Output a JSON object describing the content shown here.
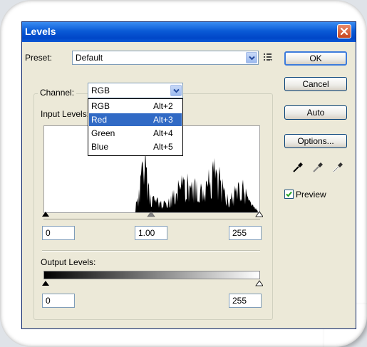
{
  "window": {
    "title": "Levels"
  },
  "preset": {
    "label": "Preset:",
    "value": "Default"
  },
  "buttons": {
    "ok": "OK",
    "cancel": "Cancel",
    "auto": "Auto",
    "options": "Options..."
  },
  "channel": {
    "label": "Channel:",
    "value": "RGB",
    "options": [
      {
        "name": "RGB",
        "shortcut": "Alt+2"
      },
      {
        "name": "Red",
        "shortcut": "Alt+3"
      },
      {
        "name": "Green",
        "shortcut": "Alt+4"
      },
      {
        "name": "Blue",
        "shortcut": "Alt+5"
      }
    ],
    "highlighted_index": 1
  },
  "input_levels": {
    "label": "Input Levels:",
    "black": "0",
    "gamma": "1.00",
    "white": "255"
  },
  "output_levels": {
    "label": "Output Levels:",
    "black": "0",
    "white": "255"
  },
  "preview": {
    "label": "Preview",
    "checked": true
  },
  "colors": {
    "title_bar": "#0a5ad6",
    "selection": "#316ac5",
    "dialog_bg": "#ece9d8"
  },
  "icons": [
    "close-icon",
    "dropdown-arrow-icon",
    "preset-menu-icon",
    "black-eyedropper-icon",
    "gray-eyedropper-icon",
    "white-eyedropper-icon",
    "checkmark-icon"
  ]
}
